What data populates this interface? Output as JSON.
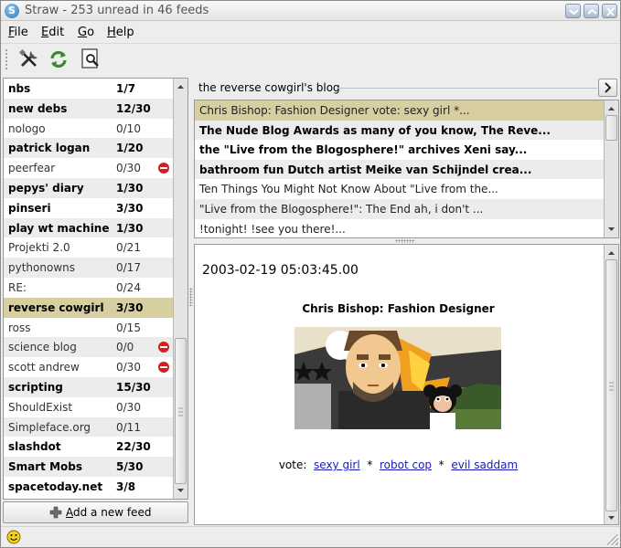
{
  "window": {
    "title": "Straw - 253 unread in 46 feeds",
    "app_icon_letter": "S"
  },
  "menubar": {
    "items": [
      {
        "label": "File",
        "mnemonic": "F",
        "rest": "ile"
      },
      {
        "label": "Edit",
        "mnemonic": "E",
        "rest": "dit"
      },
      {
        "label": "Go",
        "mnemonic": "G",
        "rest": "o"
      },
      {
        "label": "Help",
        "mnemonic": "H",
        "rest": "elp"
      }
    ]
  },
  "toolbar": {
    "tools": [
      {
        "icon": "preferences-tools-icon"
      },
      {
        "icon": "refresh-icon"
      },
      {
        "icon": "find-icon"
      }
    ]
  },
  "feeds": [
    {
      "name": "nbs",
      "count": "1/7",
      "unread": true,
      "error": false
    },
    {
      "name": "new debs",
      "count": "12/30",
      "unread": true,
      "error": false
    },
    {
      "name": "nologo",
      "count": "0/10",
      "unread": false,
      "error": false
    },
    {
      "name": "patrick logan",
      "count": "1/20",
      "unread": true,
      "error": false
    },
    {
      "name": "peerfear",
      "count": "0/30",
      "unread": false,
      "error": true
    },
    {
      "name": "pepys' diary",
      "count": "1/30",
      "unread": true,
      "error": false
    },
    {
      "name": "pinseri",
      "count": "3/30",
      "unread": true,
      "error": false
    },
    {
      "name": "play wt machine",
      "count": "1/30",
      "unread": true,
      "error": false
    },
    {
      "name": "Projekti 2.0",
      "count": "0/21",
      "unread": false,
      "error": false
    },
    {
      "name": "pythonowns",
      "count": "0/17",
      "unread": false,
      "error": false
    },
    {
      "name": "RE:",
      "count": "0/24",
      "unread": false,
      "error": false
    },
    {
      "name": "reverse cowgirl",
      "count": "3/30",
      "unread": true,
      "error": false,
      "selected": true
    },
    {
      "name": "ross",
      "count": "0/15",
      "unread": false,
      "error": false
    },
    {
      "name": "science blog",
      "count": "0/0",
      "unread": false,
      "error": true
    },
    {
      "name": "scott andrew",
      "count": "0/30",
      "unread": false,
      "error": true
    },
    {
      "name": "scripting",
      "count": "15/30",
      "unread": true,
      "error": false
    },
    {
      "name": "ShouldExist",
      "count": "0/30",
      "unread": false,
      "error": false
    },
    {
      "name": "Simpleface.org",
      "count": "0/11",
      "unread": false,
      "error": false
    },
    {
      "name": "slashdot",
      "count": "22/30",
      "unread": true,
      "error": false
    },
    {
      "name": "Smart Mobs",
      "count": "5/30",
      "unread": true,
      "error": false
    },
    {
      "name": "spacetoday.net",
      "count": "3/8",
      "unread": true,
      "error": false
    }
  ],
  "add_feed": {
    "mnemonic": "A",
    "rest": "dd a new feed"
  },
  "feed_title": "the reverse cowgirl's blog",
  "items": [
    {
      "title": "Chris Bishop: Fashion Designer vote:  sexy girl  *...",
      "unread": false,
      "selected": true
    },
    {
      "title": "The Nude Blog Awards as many of you know, The Reve...",
      "unread": true
    },
    {
      "title": "the \"Live from the Blogosphere!\" archives Xeni say...",
      "unread": true
    },
    {
      "title": "bathroom fun Dutch artist Meike van Schijndel crea...",
      "unread": true
    },
    {
      "title": "Ten Things You Might Not Know About \"Live from the...",
      "unread": false
    },
    {
      "title": "\"Live from the Blogosphere!\": The End ah, i don't ...",
      "unread": false
    },
    {
      "title": "!tonight! !see you there!...",
      "unread": false
    }
  ],
  "content": {
    "date": "2003-02-19 05:03:45.00",
    "heading": "Chris Bishop: Fashion Designer",
    "vote_prefix": "vote:",
    "links": [
      "sexy girl",
      "robot cop",
      "evil saddam"
    ],
    "separator": "*"
  },
  "colors": {
    "selection": "#d8cfa0",
    "link": "#1a1ab8",
    "error": "#d02020"
  }
}
